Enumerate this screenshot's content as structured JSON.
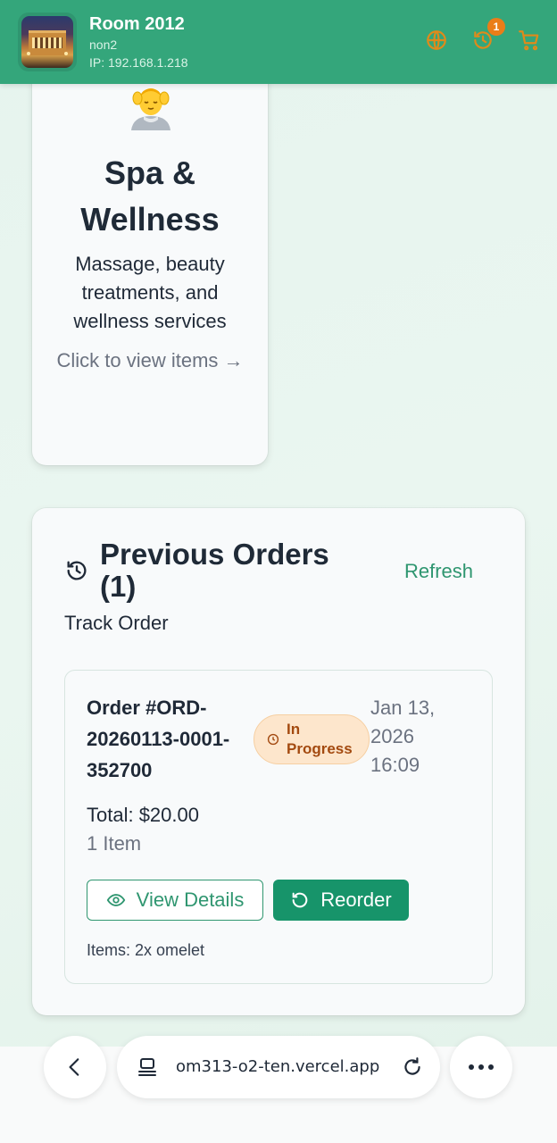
{
  "header": {
    "title": "Room 2012",
    "subtitle": "non2",
    "ip": "IP: 192.168.1.218",
    "history_badge": "1",
    "icons": [
      "globe-icon",
      "history-icon",
      "cart-icon"
    ],
    "color": "#34a67b"
  },
  "spa": {
    "emoji": "💆",
    "title": "Spa & Wellness",
    "description": "Massage, beauty treatments, and wellness services",
    "cta": "Click to view items →"
  },
  "orders": {
    "title": "Previous Orders (1)",
    "refresh_label": "Refresh",
    "track_label": "Track Order",
    "list": [
      {
        "number": "Order #ORD-20260113-0001-352700",
        "status": "In Progress",
        "date": "Jan 13, 2026 16:09",
        "total": "Total: $20.00",
        "count": "1 Item",
        "view_label": "View Details",
        "reorder_label": "Reorder",
        "items": "Items: 2x omelet"
      }
    ]
  },
  "browser": {
    "url": "om313-o2-ten.vercel.app"
  },
  "colors": {
    "accent": "#2f9670",
    "primary_button": "#17946a",
    "status_bg": "#fde6cc",
    "status_text": "#a34a10",
    "badge": "#ea7d18"
  }
}
